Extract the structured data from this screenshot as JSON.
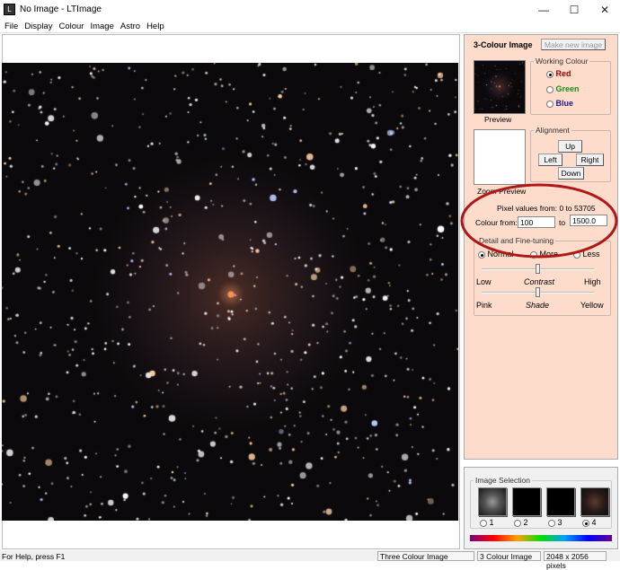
{
  "window": {
    "title": "No Image - LTImage",
    "minimize": "—",
    "maximize": "☐",
    "close": "✕"
  },
  "menu": [
    "File",
    "Display",
    "Colour",
    "Image",
    "Astro",
    "Help"
  ],
  "panel": {
    "title": "3-Colour Image",
    "make_new": "Make new image",
    "preview_label": "Preview",
    "working_colour": {
      "label": "Working Colour",
      "options": [
        {
          "label": "Red",
          "color": "#9b0000",
          "selected": true
        },
        {
          "label": "Green",
          "color": "#1a8a1a",
          "selected": false
        },
        {
          "label": "Blue",
          "color": "#1a1a8a",
          "selected": false
        }
      ]
    },
    "alignment": {
      "label": "Alignment",
      "up": "Up",
      "left": "Left",
      "right": "Right",
      "down": "Down"
    },
    "zoom_preview_label": "Zoom Preview",
    "pixel_values": "Pixel values from: 0 to 53705",
    "colour_from_label": "Colour from:",
    "colour_from": "100",
    "to_label": "to",
    "colour_to": "1500.0",
    "detail": {
      "label": "Detail and Fine-tuning",
      "options": [
        {
          "label": "Normal",
          "selected": true
        },
        {
          "label": "More",
          "selected": false
        },
        {
          "label": "Less",
          "selected": false
        }
      ],
      "contrast": {
        "low": "Low",
        "name": "Contrast",
        "high": "High",
        "value": 0.5
      },
      "shade": {
        "low": "Pink",
        "name": "Shade",
        "high": "Yellow",
        "value": 0.5
      }
    }
  },
  "image_selection": {
    "label": "Image Selection",
    "items": [
      {
        "label": "1",
        "selected": false
      },
      {
        "label": "2",
        "selected": false
      },
      {
        "label": "3",
        "selected": false
      },
      {
        "label": "4",
        "selected": true
      }
    ]
  },
  "status": {
    "help": "For Help, press F1",
    "mode": "Three Colour Image",
    "type": "3 Colour Image",
    "size": "2048 x 2056 pixels"
  }
}
